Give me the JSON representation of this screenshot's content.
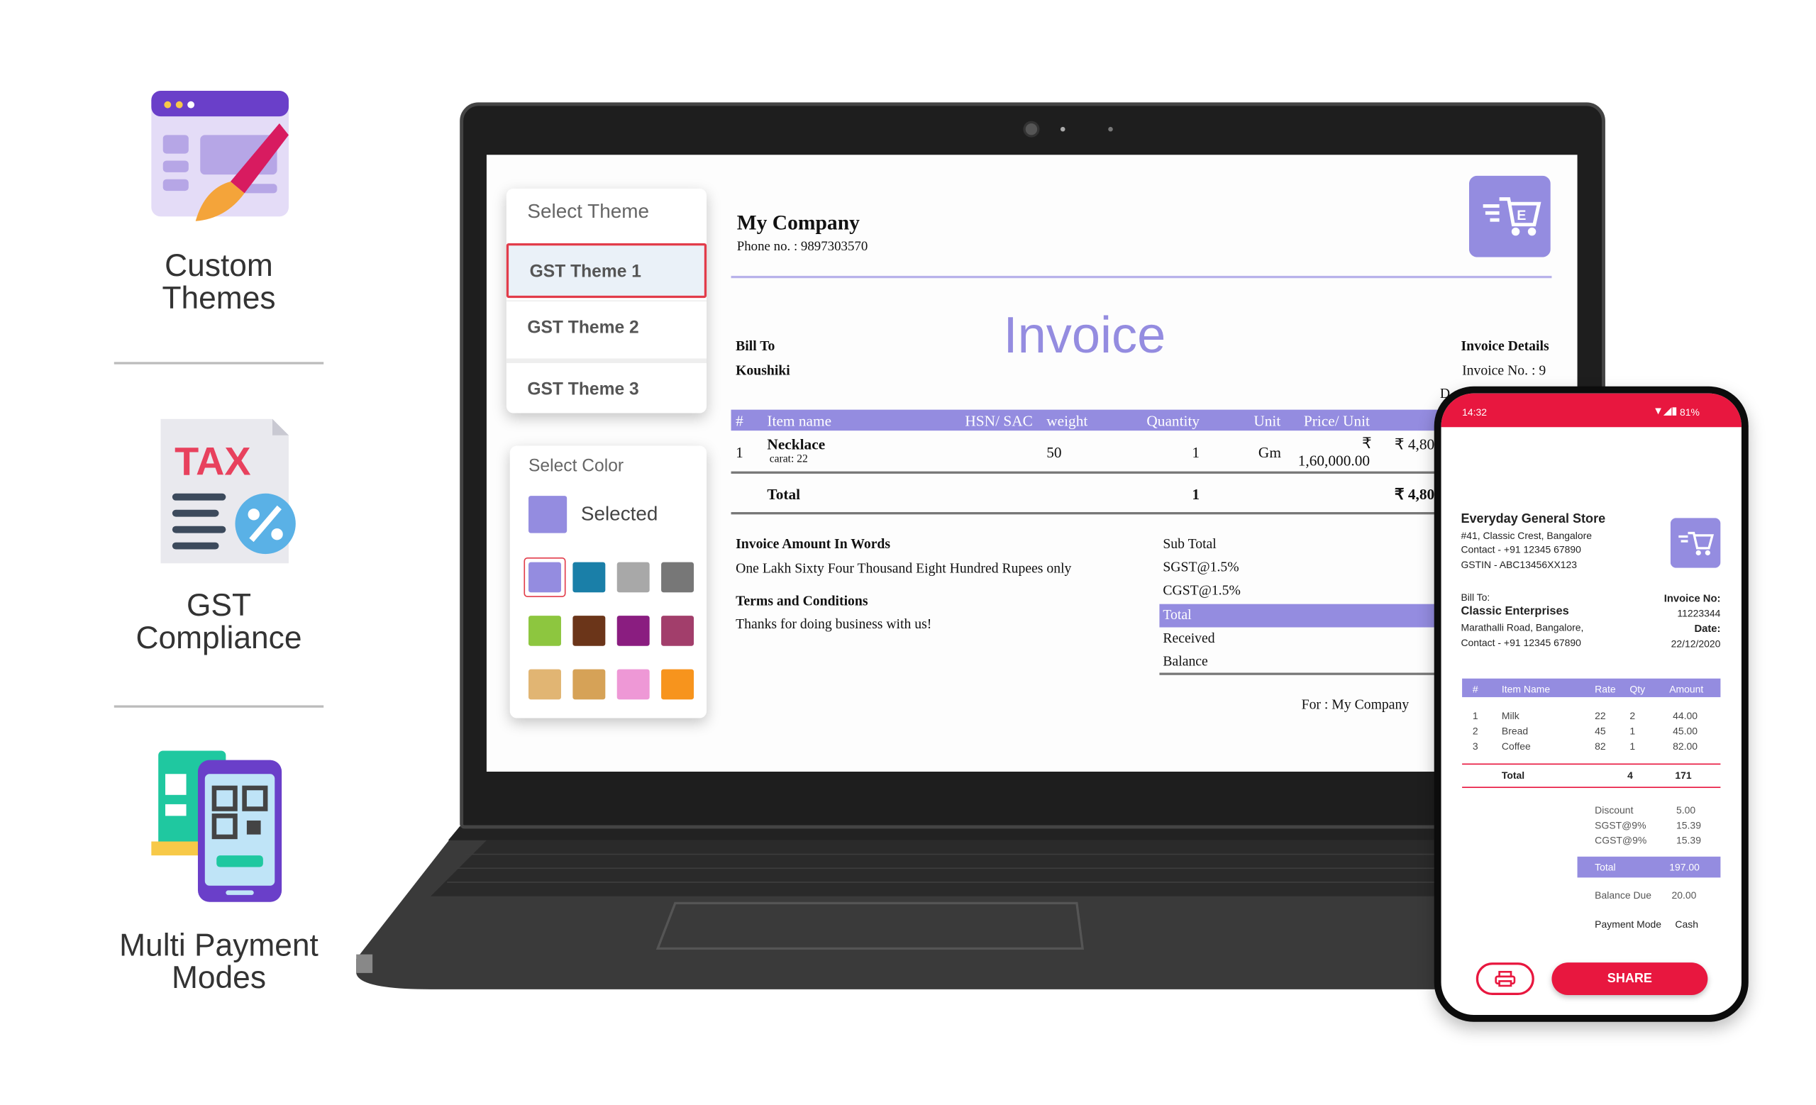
{
  "features": [
    {
      "icon": "paint-brush-theme-icon",
      "label_line1": "Custom",
      "label_line2": "Themes"
    },
    {
      "icon": "tax-document-percent-icon",
      "label_line1": "GST",
      "label_line2": "Compliance",
      "icon_text": "TAX"
    },
    {
      "icon": "qr-phone-payment-icon",
      "label_line1": "Multi Payment",
      "label_line2": "Modes"
    }
  ],
  "colors": {
    "accent": "#948ce0",
    "red": "#e8173f",
    "laptop": "#1e1e1e"
  },
  "theme_panel": {
    "title": "Select Theme",
    "items": [
      "GST Theme 1",
      "GST Theme 2",
      "GST Theme 3"
    ],
    "selected": "GST Theme 1"
  },
  "color_panel": {
    "title": "Select Color",
    "selected_label": "Selected",
    "swatches": [
      "#948ce0",
      "#1a7fa8",
      "#a8a8a8",
      "#777777",
      "#8dc63f",
      "#6b3519",
      "#8a1d80",
      "#a23e6b",
      "#e1b573",
      "#d6a257",
      "#ee98d6",
      "#f7941d"
    ]
  },
  "invoice": {
    "company": "My Company",
    "phone": "Phone no. : 9897303570",
    "title": "Invoice",
    "bill_to_label": "Bill To",
    "bill_to": "Koushiki",
    "details_label": "Invoice Details",
    "invoice_no": "Invoice No. : 9",
    "date_partial": "D",
    "columns": [
      "#",
      "Item name",
      "HSN/ SAC",
      "weight",
      "Quantity",
      "Unit",
      "Price/ Unit"
    ],
    "row": {
      "num": "1",
      "item": "Necklace",
      "sub": "carat: 22",
      "weight": "50",
      "qty": "1",
      "unit": "Gm",
      "price_symbol": "₹",
      "price": "1,60,000.00",
      "amount": "₹ 4,80"
    },
    "total_label": "Total",
    "total_qty": "1",
    "total_amount": "₹ 4,80",
    "words_label": "Invoice Amount In Words",
    "words": "One Lakh Sixty Four Thousand Eight Hundred Rupees only",
    "terms_label": "Terms and Conditions",
    "terms": "Thanks for doing business with us!",
    "summary": [
      "Sub Total",
      "SGST@1.5%",
      "CGST@1.5%",
      "Total",
      "Received",
      "Balance"
    ],
    "signature": "For : My Company"
  },
  "phone": {
    "time": "14:32",
    "battery": "81%",
    "store": "Everyday General Store",
    "address": "#41, Classic Crest, Bangalore",
    "contact": "Contact - +91 12345 67890",
    "gstin": "GSTIN - ABC13456XX123",
    "bill_to_label": "Bill To:",
    "customer": "Classic Enterprises",
    "customer_address": "Marathalli Road, Bangalore,",
    "customer_contact": "Contact - +91 12345 67890",
    "invoice_no_label": "Invoice No:",
    "invoice_no": "11223344",
    "date_label": "Date:",
    "date": "22/12/2020",
    "columns": [
      "#",
      "Item Name",
      "Rate",
      "Qty",
      "Amount"
    ],
    "rows": [
      [
        "1",
        "Milk",
        "22",
        "2",
        "44.00"
      ],
      [
        "2",
        "Bread",
        "45",
        "1",
        "45.00"
      ],
      [
        "3",
        "Coffee",
        "82",
        "1",
        "82.00"
      ]
    ],
    "total_label": "Total",
    "total_qty": "4",
    "total_amount": "171",
    "summary": [
      [
        "Discount",
        "5.00"
      ],
      [
        "SGST@9%",
        "15.39"
      ],
      [
        "CGST@9%",
        "15.39"
      ]
    ],
    "grand_total_label": "Total",
    "grand_total": "197.00",
    "balance_label": "Balance Due",
    "balance": "20.00",
    "payment_label": "Payment Mode",
    "payment": "Cash",
    "share_label": "SHARE"
  }
}
